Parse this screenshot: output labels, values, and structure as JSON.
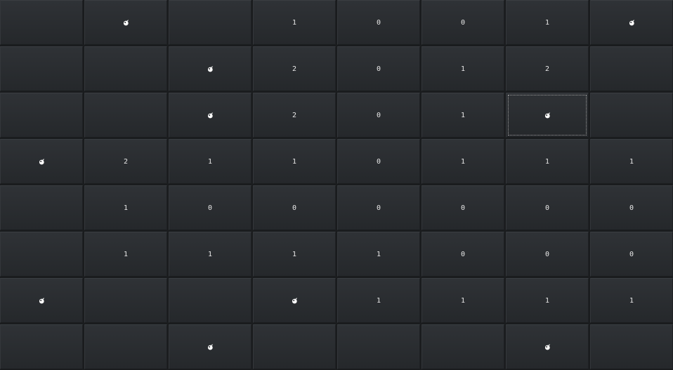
{
  "board": {
    "rows": 8,
    "cols": 8,
    "focused_cell": [
      2,
      6
    ],
    "cells": [
      [
        "",
        "mine",
        "",
        "1",
        "0",
        "0",
        "1",
        "mine"
      ],
      [
        "",
        "",
        "mine",
        "2",
        "0",
        "1",
        "2",
        ""
      ],
      [
        "",
        "",
        "mine",
        "2",
        "0",
        "1",
        "mine",
        ""
      ],
      [
        "mine",
        "2",
        "1",
        "1",
        "0",
        "1",
        "1",
        "1"
      ],
      [
        "",
        "1",
        "0",
        "0",
        "0",
        "0",
        "0",
        "0"
      ],
      [
        "",
        "1",
        "1",
        "1",
        "1",
        "0",
        "0",
        "0"
      ],
      [
        "mine",
        "",
        "",
        "mine",
        "1",
        "1",
        "1",
        "1"
      ],
      [
        "",
        "",
        "mine",
        "",
        "",
        "",
        "mine",
        ""
      ]
    ]
  },
  "icons": {
    "mine": "bomb-icon"
  },
  "colors": {
    "cell_bg": "#2b2e31",
    "text": "#e8e8e8",
    "mine": "#ffffff"
  }
}
